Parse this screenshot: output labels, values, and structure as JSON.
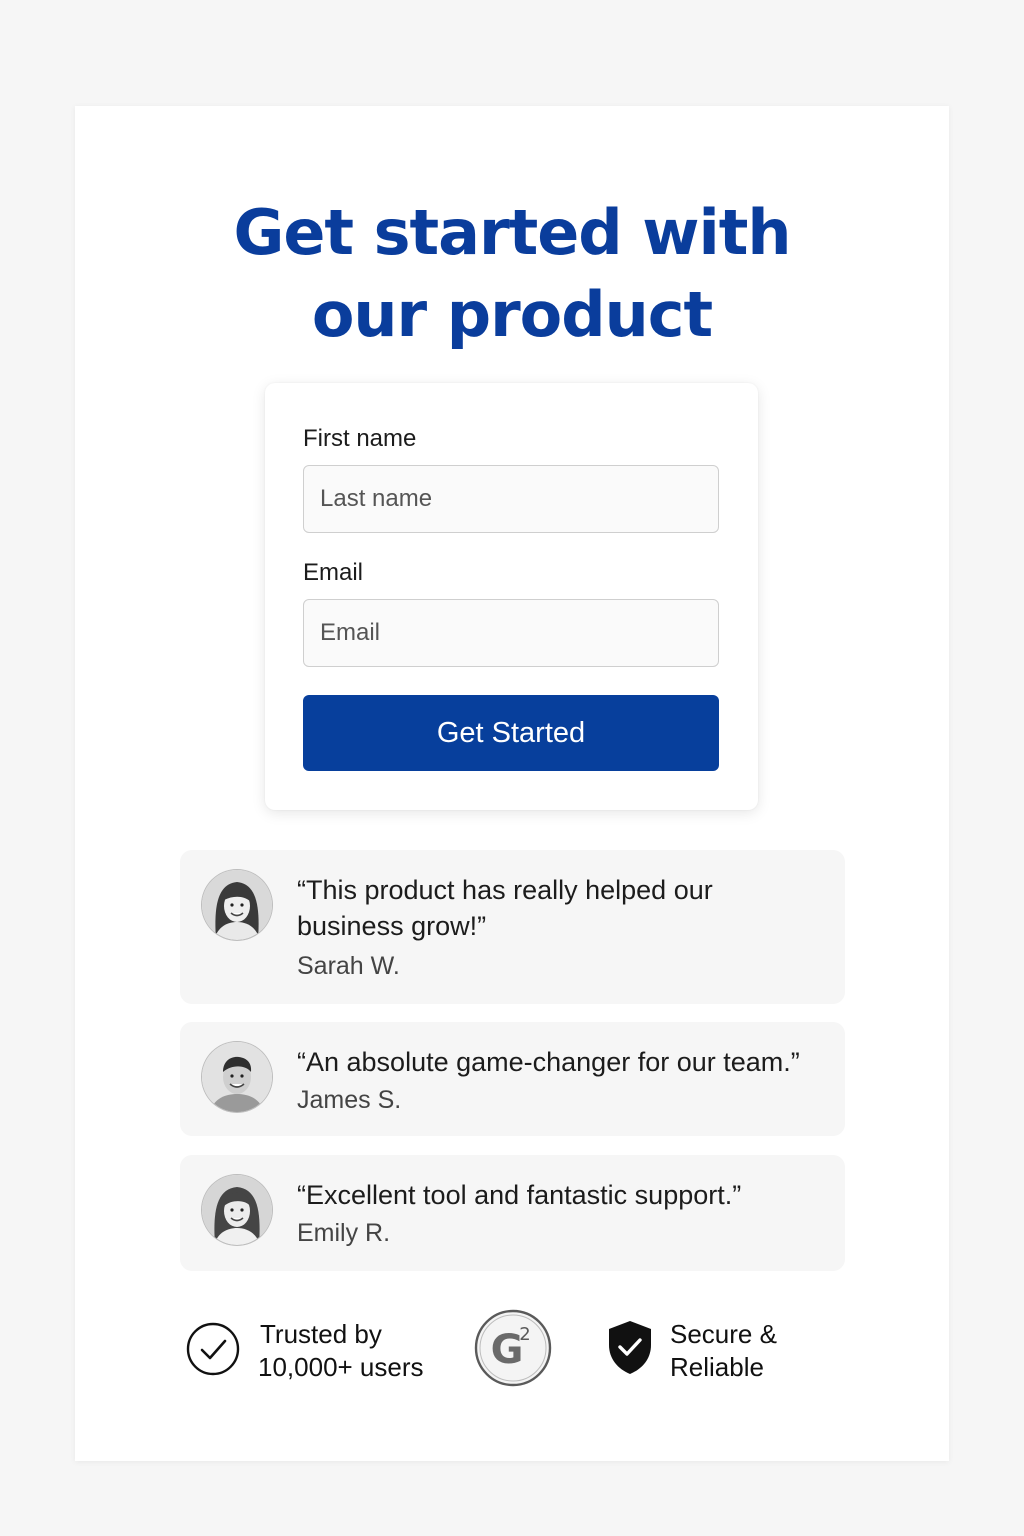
{
  "headline": {
    "line1": "Get started with",
    "line2": "our product"
  },
  "form": {
    "first_name_label": "First name",
    "name_placeholder": "Last name",
    "email_label": "Email",
    "email_placeholder": "Email",
    "submit_label": "Get Started"
  },
  "testimonials": [
    {
      "quote_line1": "“This product has really helped our",
      "quote_line2": "business grow!”",
      "author": "Sarah W."
    },
    {
      "quote_line1": "“An absolute game-changer for our team.”",
      "author": "James S."
    },
    {
      "quote_line1": "“Excellent tool and fantastic support.”",
      "author": "Emily R."
    }
  ],
  "trust": {
    "users_line1": "Trusted by",
    "users_line2": "10,000+ users",
    "g2_text": "G",
    "g2_superscript": "2",
    "secure_line1": "Secure &",
    "secure_line2": "Reliable"
  },
  "colors": {
    "brand_blue": "#0a3d9c",
    "button_blue": "#073f9c",
    "page_background": "#f6f6f6",
    "testimonial_background": "#f6f6f6"
  },
  "icons": [
    "check-circle-icon",
    "g2-badge-icon",
    "shield-check-icon"
  ]
}
